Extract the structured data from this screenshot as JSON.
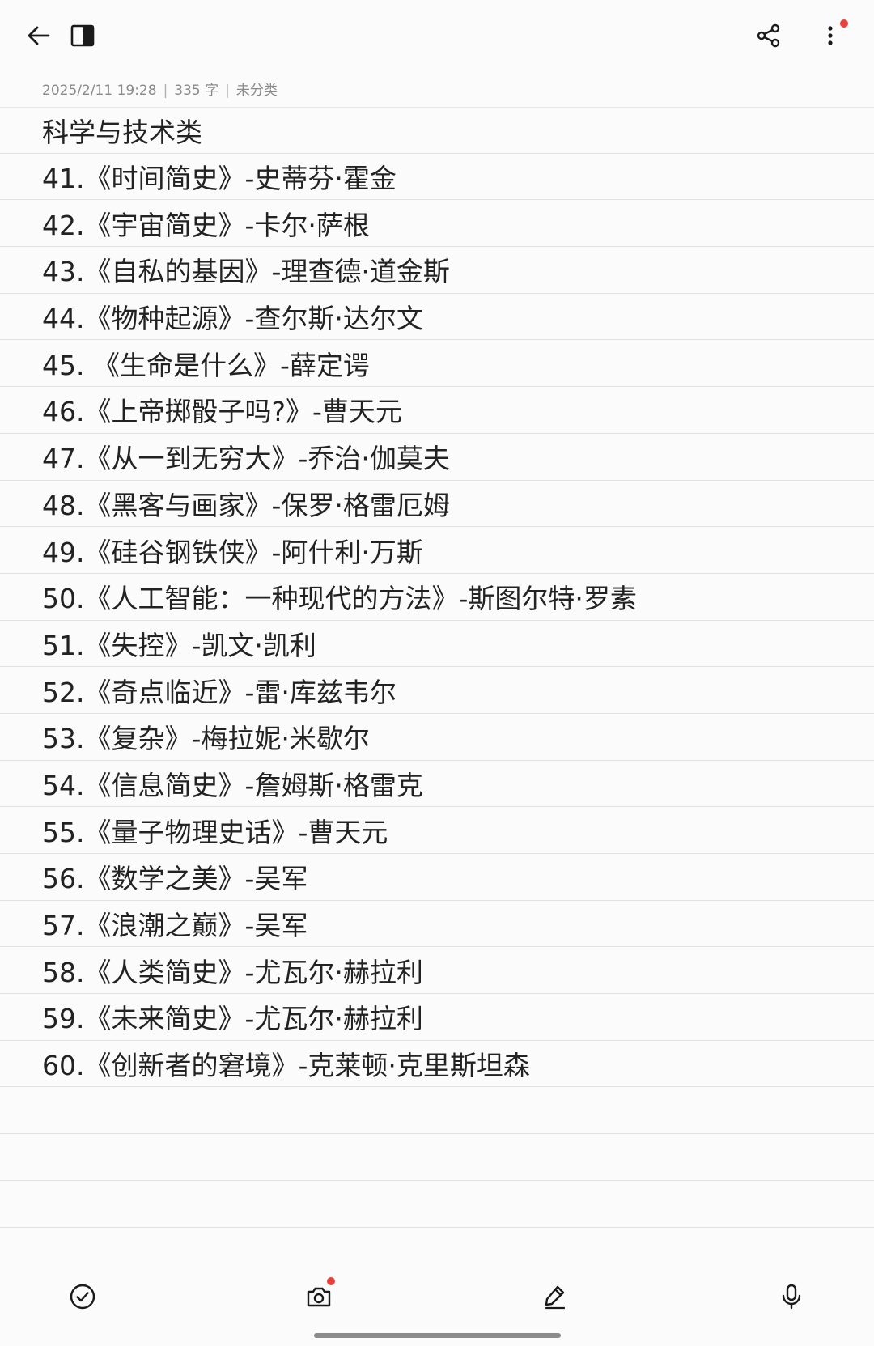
{
  "header": {
    "icons": {
      "back": "arrow-left-icon",
      "panel": "panel-toggle-icon",
      "share": "share-icon",
      "more": "more-vertical-icon"
    },
    "accent_dot_color": "#e8413b"
  },
  "meta": {
    "datetime": "2025/2/11 19:28",
    "word_count": "335 字",
    "category": "未分类"
  },
  "note": {
    "title": "科学与技术类",
    "lines": [
      "41.《时间简史》-史蒂芬·霍金",
      "42.《宇宙简史》-卡尔·萨根",
      "43.《自私的基因》-理查德·道金斯",
      "44.《物种起源》-查尔斯·达尔文",
      "45. 《生命是什么》-薛定谔",
      "46.《上帝掷骰子吗?》-曹天元",
      "47.《从一到无穷大》-乔治·伽莫夫",
      "48.《黑客与画家》-保罗·格雷厄姆",
      "49.《硅谷钢铁侠》-阿什利·万斯",
      "50.《人工智能：一种现代的方法》-斯图尔特·罗素",
      "51.《失控》-凯文·凯利",
      "52.《奇点临近》-雷·库兹韦尔",
      "53.《复杂》-梅拉妮·米歇尔",
      "54.《信息简史》-詹姆斯·格雷克",
      "55.《量子物理史话》-曹天元",
      "56.《数学之美》-吴军",
      "57.《浪潮之巅》-吴军",
      "58.《人类简史》-尤瓦尔·赫拉利",
      "59.《未来简史》-尤瓦尔·赫拉利",
      "60.《创新者的窘境》-克莱顿·克里斯坦森"
    ]
  },
  "toolbar": {
    "icons": [
      "checklist-icon",
      "camera-icon",
      "pen-icon",
      "microphone-icon"
    ]
  }
}
